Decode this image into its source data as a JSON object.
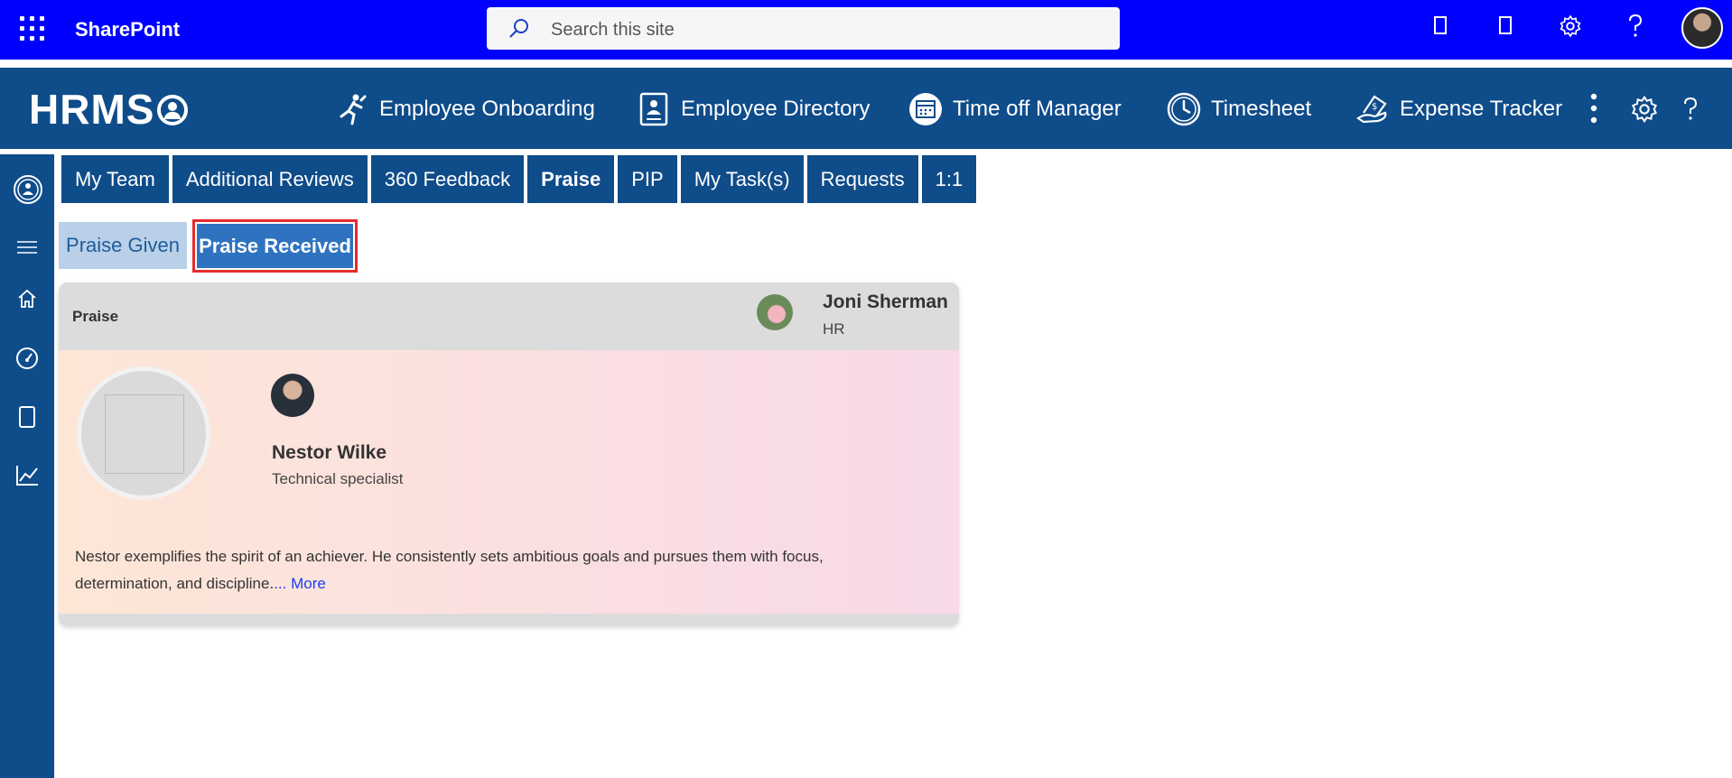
{
  "suite_bar": {
    "app_name": "SharePoint",
    "search_placeholder": "Search this site"
  },
  "hrms_header": {
    "logo": "HRMS",
    "nav": [
      {
        "label": "Employee Onboarding",
        "icon": "onboarding-runner-icon"
      },
      {
        "label": "Employee Directory",
        "icon": "directory-book-icon"
      },
      {
        "label": "Time off Manager",
        "icon": "calendar-icon"
      },
      {
        "label": "Timesheet",
        "icon": "clock-icon"
      },
      {
        "label": "Expense Tracker",
        "icon": "money-hand-icon"
      }
    ]
  },
  "tabs": [
    "My Team",
    "Additional Reviews",
    "360 Feedback",
    "Praise",
    "PIP",
    "My Task(s)",
    "Requests",
    "1:1"
  ],
  "active_tab": "Praise",
  "sub_tabs": {
    "given": "Praise Given",
    "received": "Praise Received"
  },
  "praise_card": {
    "label": "Praise",
    "giver_name": "Joni Sherman",
    "giver_dept": "HR",
    "recipient_name": "Nestor Wilke",
    "recipient_title": "Technical specialist",
    "message": "Nestor exemplifies the spirit of an achiever. He consistently sets ambitious goals and pursues them with focus, determination, and discipline.",
    "more_link": "... More"
  },
  "colors": {
    "suite_bar": "#0000ff",
    "hrms_blue": "#0f4c8a",
    "active_subtab": "#2f73c0",
    "highlight_border": "#e52c2c"
  }
}
